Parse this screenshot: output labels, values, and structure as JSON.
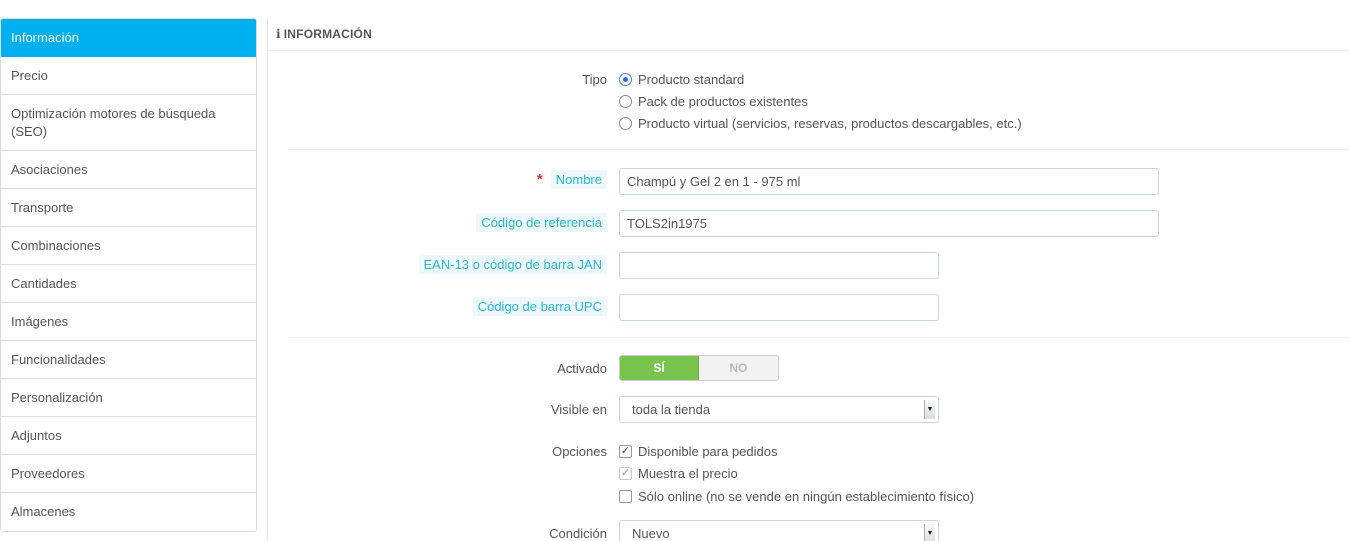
{
  "sidebar": {
    "items": [
      {
        "label": "Información",
        "active": true
      },
      {
        "label": "Precio"
      },
      {
        "label": "Optimización motores de búsqueda (SEO)"
      },
      {
        "label": "Asociaciones"
      },
      {
        "label": "Transporte"
      },
      {
        "label": "Combinaciones"
      },
      {
        "label": "Cantidades"
      },
      {
        "label": "Imágenes"
      },
      {
        "label": "Funcionalidades"
      },
      {
        "label": "Personalización"
      },
      {
        "label": "Adjuntos"
      },
      {
        "label": "Proveedores"
      },
      {
        "label": "Almacenes"
      }
    ]
  },
  "panel": {
    "title": "INFORMACIÓN",
    "title_icon": "info-icon"
  },
  "form": {
    "tipo": {
      "label": "Tipo",
      "options": [
        "Producto standard",
        "Pack de productos existentes",
        "Producto virtual (servicios, reservas, productos descargables, etc.)"
      ],
      "selected": "Producto standard"
    },
    "nombre": {
      "label": "Nombre",
      "required_mark": "*",
      "value": "Champú y Gel 2 en 1 - 975 ml"
    },
    "referencia": {
      "label": "Código de referencia",
      "value": "TOLS2in1975"
    },
    "ean": {
      "label": "EAN-13 o código de barra JAN",
      "value": ""
    },
    "upc": {
      "label": "Código de barra UPC",
      "value": ""
    },
    "activado": {
      "label": "Activado",
      "yes": "SÍ",
      "no": "NO",
      "value": "SÍ"
    },
    "visible": {
      "label": "Visible en",
      "value": "toda la tienda"
    },
    "opciones": {
      "label": "Opciones",
      "items": [
        {
          "label": "Disponible para pedidos",
          "checked": true
        },
        {
          "label": "Muestra el precio",
          "checked": true
        },
        {
          "label": "Sólo online (no se vende en ningún establecimiento físico)",
          "checked": false
        }
      ]
    },
    "condicion": {
      "label": "Condición",
      "value": "Nuevo"
    }
  },
  "colors": {
    "accent": "#00aff0",
    "switch_on": "#79c44f",
    "hint_text": "#25b9d7",
    "required": "#e52e2e"
  }
}
